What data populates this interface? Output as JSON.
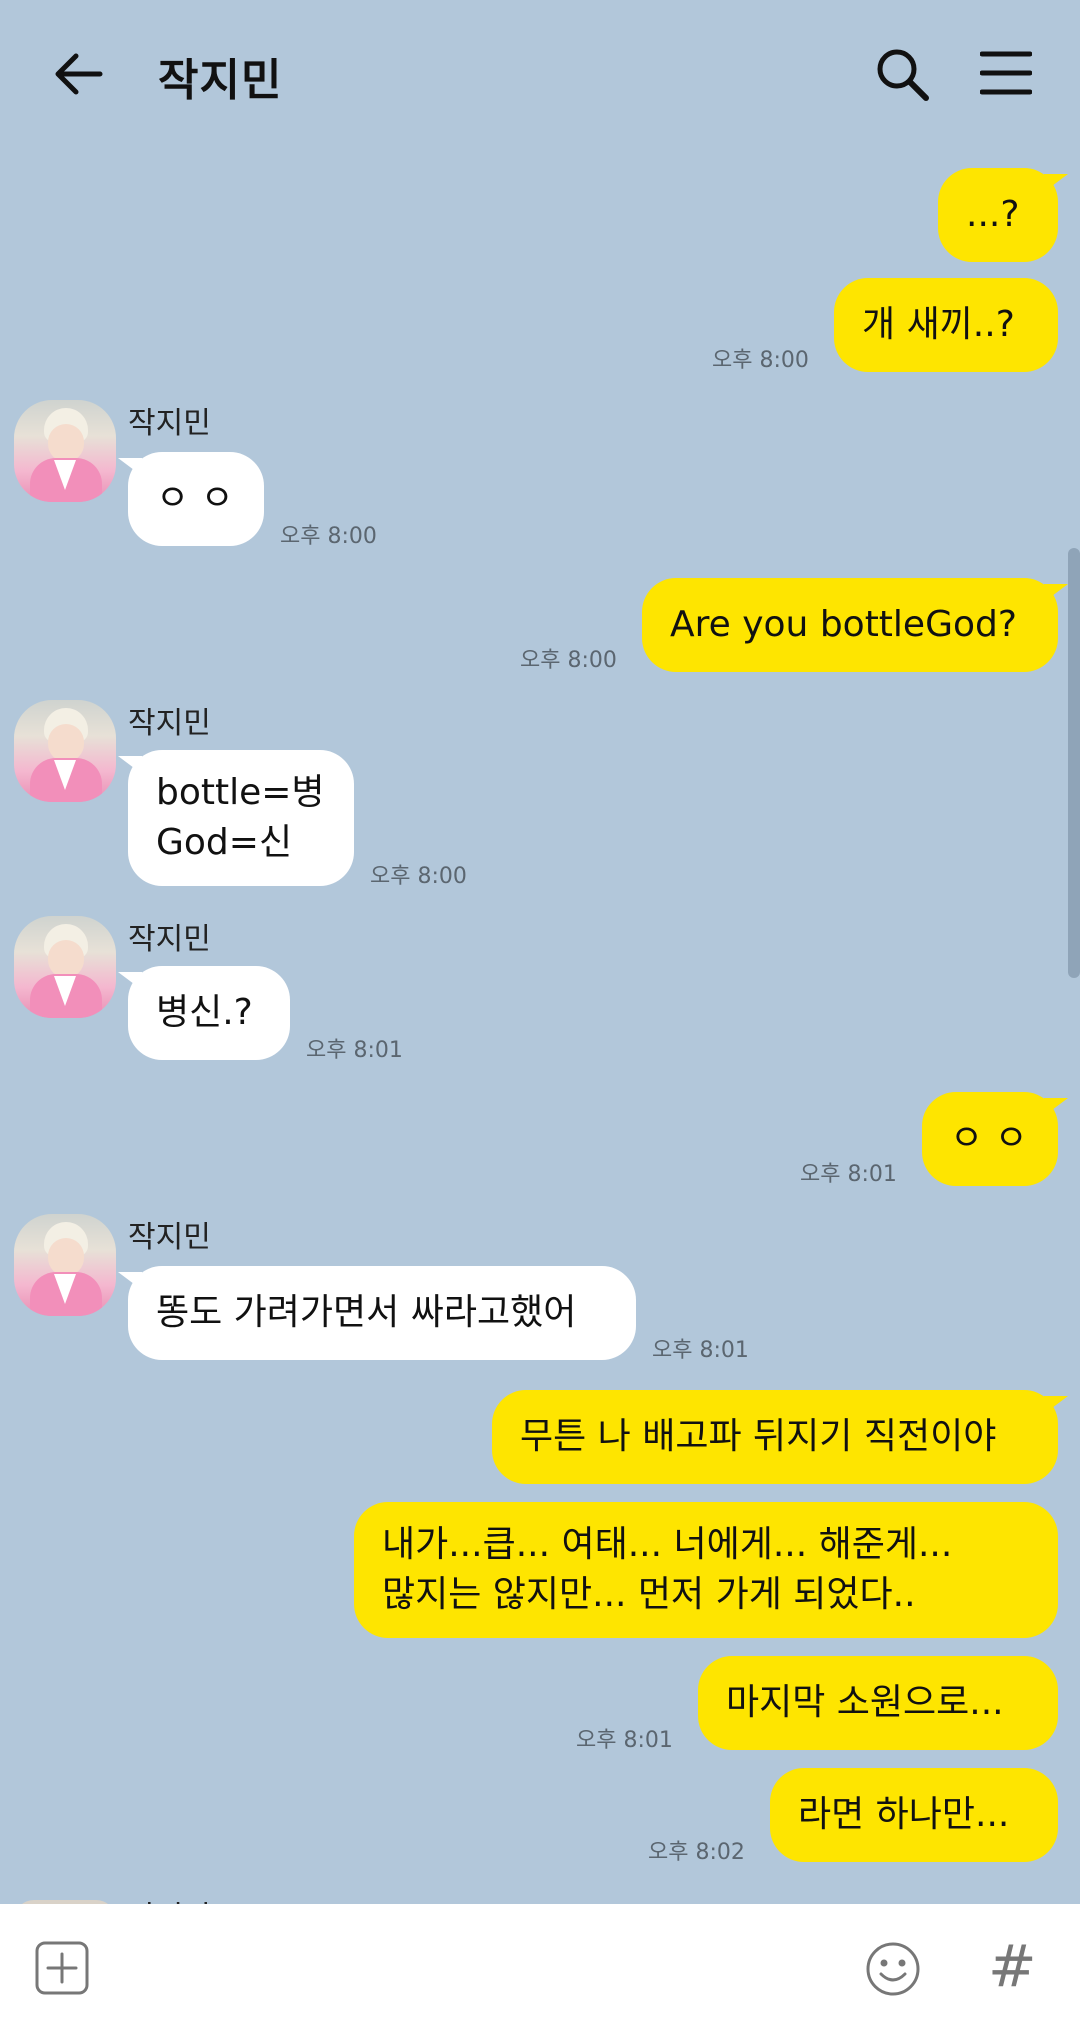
{
  "header": {
    "title": "작지민",
    "back_icon": "arrow-left-icon",
    "search_icon": "search-icon",
    "menu_icon": "hamburger-menu-icon"
  },
  "messages": [
    {
      "from": "me",
      "text": "...?"
    },
    {
      "from": "me",
      "text": "개 새끼..?",
      "time": "오후 8:00"
    },
    {
      "from": "other",
      "sender": "작지민",
      "text": "ㅇ ㅇ",
      "time": "오후 8:00"
    },
    {
      "from": "me",
      "text": "Are you bottleGod?",
      "time": "오후 8:00"
    },
    {
      "from": "other",
      "sender": "작지민",
      "text": "bottle=병\nGod=신",
      "time": "오후 8:00"
    },
    {
      "from": "other",
      "sender": "작지민",
      "text": "병신.?",
      "time": "오후 8:01"
    },
    {
      "from": "me",
      "text": "ㅇ ㅇ",
      "time": "오후 8:01"
    },
    {
      "from": "other",
      "sender": "작지민",
      "text": "똥도 가려가면서 싸라고했어",
      "time": "오후 8:01"
    },
    {
      "from": "me",
      "text": "무튼 나 배고파 뒤지기 직전이야"
    },
    {
      "from": "me",
      "text": "내가...큽... 여태... 너에게... 해준게...\n많지는 않지만... 먼저 가게 되었다.."
    },
    {
      "from": "me",
      "text": "마지막 소원으로...",
      "time": "오후 8:01"
    },
    {
      "from": "me",
      "text": "라면 하나만...",
      "time": "오후 8:02"
    }
  ],
  "partial_sender": "작지민",
  "input_bar": {
    "plus_icon": "plus-box-icon",
    "emoji_icon": "emoji-smile-icon",
    "hash_label": "#"
  },
  "colors": {
    "background": "#b2c7da",
    "my_bubble": "#fee500",
    "other_bubble": "#ffffff"
  }
}
